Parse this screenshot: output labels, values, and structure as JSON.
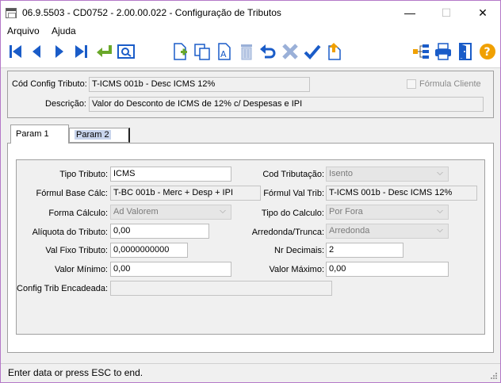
{
  "window": {
    "title": "06.9.5503 - CD0752 - 2.00.00.022 - Configuração de Tributos",
    "minimize": "—",
    "maximize": "☐",
    "close": "✕"
  },
  "menu": [
    "Arquivo",
    "Ajuda"
  ],
  "toolbar": {
    "icons": [
      "first-icon",
      "previous-icon",
      "next-icon",
      "last-icon",
      "return-icon",
      "preview-icon",
      "new-record-icon",
      "copy-icon",
      "edit-icon",
      "delete-icon",
      "undo-icon",
      "cancel-icon",
      "confirm-icon",
      "export-icon",
      "tree-icon",
      "print-icon",
      "exit-icon",
      "help-icon"
    ]
  },
  "header": {
    "cod_label": "Cód Config Tributo:",
    "cod_value": "T-ICMS 001b - Desc ICMS 12%",
    "desc_label": "Descrição:",
    "desc_value": "Valor do Desconto de ICMS de 12% c/ Despesas e IPI",
    "formula_cliente_label": "Fórmula Cliente",
    "formula_cliente_checked": false
  },
  "tabs": [
    {
      "label": "Param 1",
      "active": true
    },
    {
      "label": "Param 2",
      "active": false
    }
  ],
  "form": {
    "tipo_tributo": {
      "label": "Tipo Tributo:",
      "value": "ICMS"
    },
    "cod_tributacao": {
      "label": "Cod Tributação:",
      "value": "Isento"
    },
    "formul_base_calc": {
      "label": "Fórmul Base Cálc:",
      "value": "T-BC 001b - Merc + Desp + IPI"
    },
    "formul_val_trib": {
      "label": "Fórmul Val Trib:",
      "value": "T-ICMS 001b - Desc ICMS 12%"
    },
    "forma_calculo": {
      "label": "Forma Cálculo:",
      "value": "Ad Valorem"
    },
    "tipo_calculo": {
      "label": "Tipo do Calculo:",
      "value": "Por Fora"
    },
    "aliquota": {
      "label": "Alíquota do Tributo:",
      "value": "0,00"
    },
    "arredonda_trunca": {
      "label": "Arredonda/Trunca:",
      "value": "Arredonda"
    },
    "val_fixo": {
      "label": "Val Fixo Tributo:",
      "value": "0,0000000000"
    },
    "nr_decimais": {
      "label": "Nr Decimais:",
      "value": "2"
    },
    "valor_minimo": {
      "label": "Valor Mínimo:",
      "value": "0,00"
    },
    "valor_maximo": {
      "label": "Valor Máximo:",
      "value": "0,00"
    },
    "config_trib_encadeada": {
      "label": "Config Trib Encadeada:",
      "value": ""
    }
  },
  "status": {
    "text": "Enter data or press ESC to end."
  },
  "colors": {
    "nav_blue": "#1a5cc8",
    "return_green": "#6aa82a",
    "help_orange": "#f0a000",
    "window_border": "#b478c8"
  }
}
